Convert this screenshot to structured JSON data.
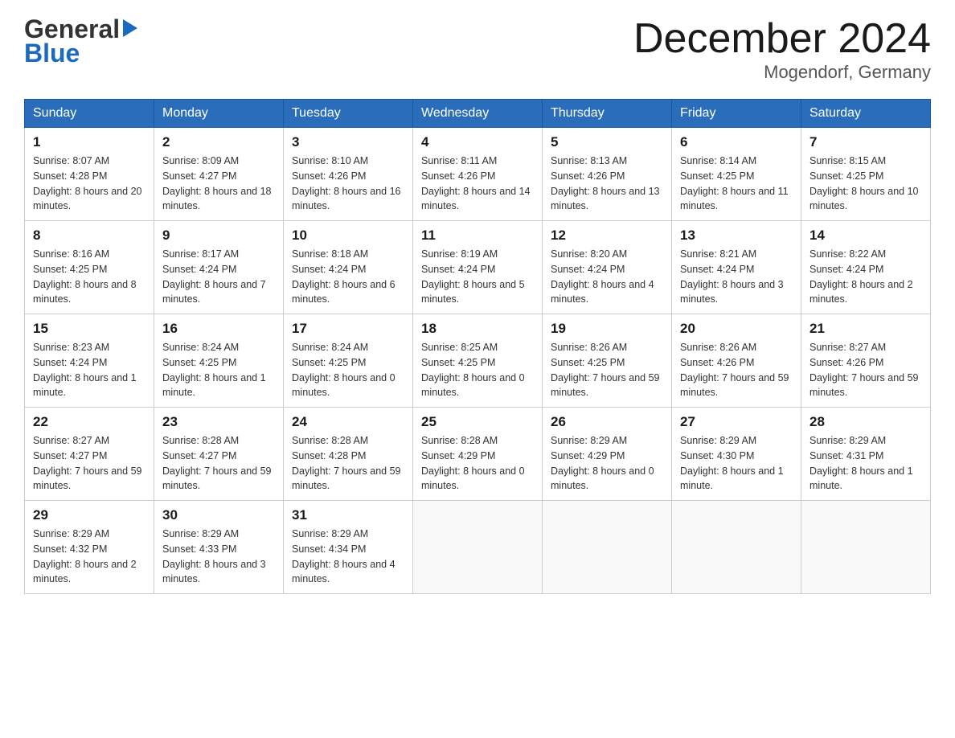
{
  "header": {
    "logo_line1": "General",
    "logo_line2": "Blue",
    "month_title": "December 2024",
    "location": "Mogendorf, Germany"
  },
  "days_of_week": [
    "Sunday",
    "Monday",
    "Tuesday",
    "Wednesday",
    "Thursday",
    "Friday",
    "Saturday"
  ],
  "weeks": [
    [
      {
        "day": "1",
        "sunrise": "8:07 AM",
        "sunset": "4:28 PM",
        "daylight": "8 hours and 20 minutes."
      },
      {
        "day": "2",
        "sunrise": "8:09 AM",
        "sunset": "4:27 PM",
        "daylight": "8 hours and 18 minutes."
      },
      {
        "day": "3",
        "sunrise": "8:10 AM",
        "sunset": "4:26 PM",
        "daylight": "8 hours and 16 minutes."
      },
      {
        "day": "4",
        "sunrise": "8:11 AM",
        "sunset": "4:26 PM",
        "daylight": "8 hours and 14 minutes."
      },
      {
        "day": "5",
        "sunrise": "8:13 AM",
        "sunset": "4:26 PM",
        "daylight": "8 hours and 13 minutes."
      },
      {
        "day": "6",
        "sunrise": "8:14 AM",
        "sunset": "4:25 PM",
        "daylight": "8 hours and 11 minutes."
      },
      {
        "day": "7",
        "sunrise": "8:15 AM",
        "sunset": "4:25 PM",
        "daylight": "8 hours and 10 minutes."
      }
    ],
    [
      {
        "day": "8",
        "sunrise": "8:16 AM",
        "sunset": "4:25 PM",
        "daylight": "8 hours and 8 minutes."
      },
      {
        "day": "9",
        "sunrise": "8:17 AM",
        "sunset": "4:24 PM",
        "daylight": "8 hours and 7 minutes."
      },
      {
        "day": "10",
        "sunrise": "8:18 AM",
        "sunset": "4:24 PM",
        "daylight": "8 hours and 6 minutes."
      },
      {
        "day": "11",
        "sunrise": "8:19 AM",
        "sunset": "4:24 PM",
        "daylight": "8 hours and 5 minutes."
      },
      {
        "day": "12",
        "sunrise": "8:20 AM",
        "sunset": "4:24 PM",
        "daylight": "8 hours and 4 minutes."
      },
      {
        "day": "13",
        "sunrise": "8:21 AM",
        "sunset": "4:24 PM",
        "daylight": "8 hours and 3 minutes."
      },
      {
        "day": "14",
        "sunrise": "8:22 AM",
        "sunset": "4:24 PM",
        "daylight": "8 hours and 2 minutes."
      }
    ],
    [
      {
        "day": "15",
        "sunrise": "8:23 AM",
        "sunset": "4:24 PM",
        "daylight": "8 hours and 1 minute."
      },
      {
        "day": "16",
        "sunrise": "8:24 AM",
        "sunset": "4:25 PM",
        "daylight": "8 hours and 1 minute."
      },
      {
        "day": "17",
        "sunrise": "8:24 AM",
        "sunset": "4:25 PM",
        "daylight": "8 hours and 0 minutes."
      },
      {
        "day": "18",
        "sunrise": "8:25 AM",
        "sunset": "4:25 PM",
        "daylight": "8 hours and 0 minutes."
      },
      {
        "day": "19",
        "sunrise": "8:26 AM",
        "sunset": "4:25 PM",
        "daylight": "7 hours and 59 minutes."
      },
      {
        "day": "20",
        "sunrise": "8:26 AM",
        "sunset": "4:26 PM",
        "daylight": "7 hours and 59 minutes."
      },
      {
        "day": "21",
        "sunrise": "8:27 AM",
        "sunset": "4:26 PM",
        "daylight": "7 hours and 59 minutes."
      }
    ],
    [
      {
        "day": "22",
        "sunrise": "8:27 AM",
        "sunset": "4:27 PM",
        "daylight": "7 hours and 59 minutes."
      },
      {
        "day": "23",
        "sunrise": "8:28 AM",
        "sunset": "4:27 PM",
        "daylight": "7 hours and 59 minutes."
      },
      {
        "day": "24",
        "sunrise": "8:28 AM",
        "sunset": "4:28 PM",
        "daylight": "7 hours and 59 minutes."
      },
      {
        "day": "25",
        "sunrise": "8:28 AM",
        "sunset": "4:29 PM",
        "daylight": "8 hours and 0 minutes."
      },
      {
        "day": "26",
        "sunrise": "8:29 AM",
        "sunset": "4:29 PM",
        "daylight": "8 hours and 0 minutes."
      },
      {
        "day": "27",
        "sunrise": "8:29 AM",
        "sunset": "4:30 PM",
        "daylight": "8 hours and 1 minute."
      },
      {
        "day": "28",
        "sunrise": "8:29 AM",
        "sunset": "4:31 PM",
        "daylight": "8 hours and 1 minute."
      }
    ],
    [
      {
        "day": "29",
        "sunrise": "8:29 AM",
        "sunset": "4:32 PM",
        "daylight": "8 hours and 2 minutes."
      },
      {
        "day": "30",
        "sunrise": "8:29 AM",
        "sunset": "4:33 PM",
        "daylight": "8 hours and 3 minutes."
      },
      {
        "day": "31",
        "sunrise": "8:29 AM",
        "sunset": "4:34 PM",
        "daylight": "8 hours and 4 minutes."
      },
      null,
      null,
      null,
      null
    ]
  ],
  "labels": {
    "sunrise": "Sunrise:",
    "sunset": "Sunset:",
    "daylight": "Daylight:"
  }
}
